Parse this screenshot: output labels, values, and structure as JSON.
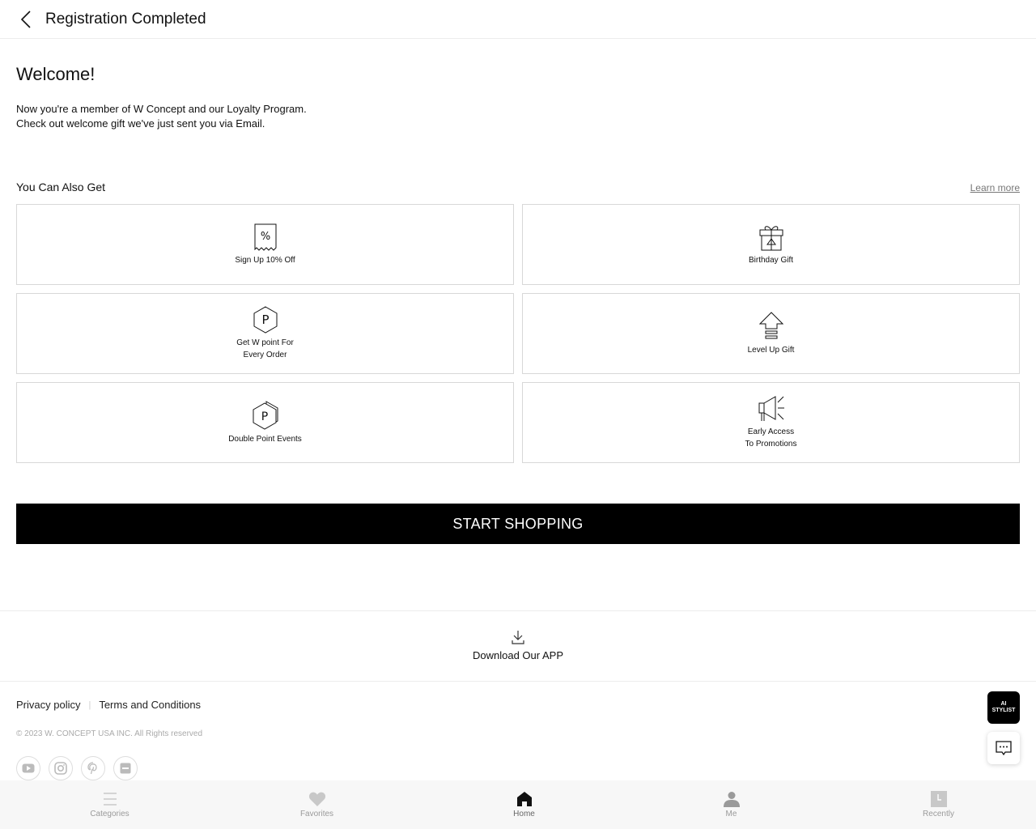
{
  "header": {
    "title": "Registration Completed",
    "back_icon": "chevron-left-icon"
  },
  "welcome": {
    "heading": "Welcome!",
    "line1": "Now you're a member of W Concept and our Loyalty Program.",
    "line2": "Check out welcome gift we've just sent you via Email."
  },
  "benefits": {
    "title": "You Can Also Get",
    "learn_more": "Learn more",
    "items": [
      {
        "label": "Sign Up 10% Off",
        "icon": "coupon-icon"
      },
      {
        "label": "Birthday Gift",
        "icon": "gift-icon"
      },
      {
        "label_line1": "Get W point For",
        "label_line2": "Every Order",
        "icon": "point-icon"
      },
      {
        "label": "Level Up Gift",
        "icon": "level-up-icon"
      },
      {
        "label": "Double Point Events",
        "icon": "double-point-icon"
      },
      {
        "label_line1": "Early Access",
        "label_line2": "To Promotions",
        "icon": "megaphone-icon"
      }
    ]
  },
  "cta": {
    "label": "START SHOPPING"
  },
  "app": {
    "label": "Download Our APP",
    "icon": "download-icon"
  },
  "footer": {
    "privacy": "Privacy policy",
    "separator": "|",
    "terms": "Terms and Conditions",
    "copyright": "© 2023 W. CONCEPT USA INC. All Rights reserved",
    "socials": [
      "youtube-icon",
      "instagram-icon",
      "pinterest-icon",
      "app-icon"
    ]
  },
  "floating": {
    "ai_line1": "AI",
    "ai_line2": "STYLIST",
    "chat_icon": "chat-icon"
  },
  "nav": {
    "items": [
      {
        "label": "Categories",
        "icon": "menu-icon"
      },
      {
        "label": "Favorites",
        "icon": "heart-icon"
      },
      {
        "label": "Home",
        "icon": "home-icon"
      },
      {
        "label": "Me",
        "icon": "person-icon"
      },
      {
        "label": "Recently",
        "icon": "clock-icon"
      }
    ],
    "active": "Home"
  }
}
